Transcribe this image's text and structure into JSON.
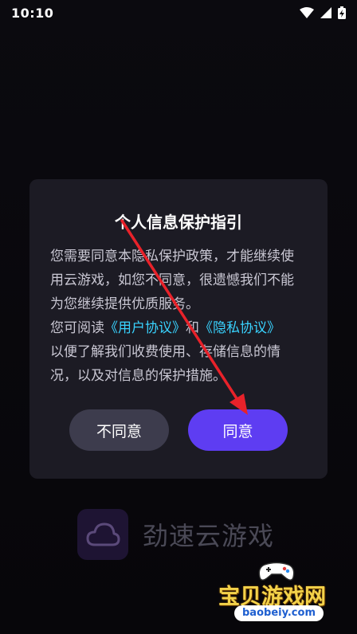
{
  "status_bar": {
    "time": "10:10",
    "icons": [
      "wifi-icon",
      "signal-icon",
      "battery-charging-icon"
    ]
  },
  "dialog": {
    "title": "个人信息保护指引",
    "body_line1": "您需要同意本隐私保护政策，才能继续使",
    "body_line2": "用云游戏，如您不同意，很遗憾我们不能",
    "body_line3": "为您继续提供优质服务。",
    "body_line4_prefix": "您可阅读",
    "user_agreement_link": "《用户协议》",
    "body_line4_and": "和",
    "privacy_link": "《隐私协议》",
    "body_line5": "以便了解我们收费使用、存储信息的情",
    "body_line6": "况，以及对信息的保护措施。",
    "disagree_label": "不同意",
    "agree_label": "同意"
  },
  "brand": {
    "name": "劲速云游戏",
    "logo_icon": "cloud-icon"
  },
  "watermark": {
    "text": "宝贝游戏网",
    "url": "baobeiy.com",
    "icon": "gamepad-icon"
  },
  "colors": {
    "background": "#08070b",
    "dialog_bg": "#1c1b24",
    "agree_button": "#5e3df2",
    "disagree_button": "#3d3c4d",
    "link": "#39d3ff",
    "annotation_arrow": "#e8222a"
  }
}
